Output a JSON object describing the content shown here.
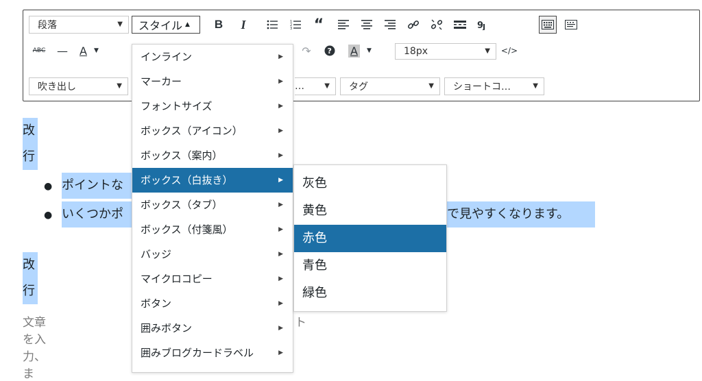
{
  "toolbar": {
    "row1": {
      "format_select": "段落",
      "style_button": "スタイル",
      "bold": "B",
      "italic": "I"
    },
    "row2": {
      "strike_label": "ABC",
      "hr_glyph": "—",
      "text_color_label": "A",
      "bg_color_label": "A",
      "font_size_select": "18px",
      "code_icon": "</>"
    },
    "row3": {
      "speech_bubble_select": "吹き出し",
      "partial_select": "…",
      "tag_select": "タグ",
      "shortcode_select": "ショートコ…"
    }
  },
  "style_menu": {
    "items": [
      {
        "label": "インライン"
      },
      {
        "label": "マーカー"
      },
      {
        "label": "フォントサイズ"
      },
      {
        "label": "ボックス（アイコン）"
      },
      {
        "label": "ボックス（案内）"
      },
      {
        "label": "ボックス（白抜き）"
      },
      {
        "label": "ボックス（タブ）"
      },
      {
        "label": "ボックス（付箋風）"
      },
      {
        "label": "バッジ"
      },
      {
        "label": "マイクロコピー"
      },
      {
        "label": "ボタン"
      },
      {
        "label": "囲みボタン"
      },
      {
        "label": "囲みブログカードラベル"
      }
    ],
    "active_index": 5
  },
  "submenu": {
    "items": [
      {
        "label": "灰色"
      },
      {
        "label": "黄色"
      },
      {
        "label": "赤色"
      },
      {
        "label": "青色"
      },
      {
        "label": "緑色"
      }
    ],
    "active_index": 2
  },
  "content": {
    "para1": "改行",
    "bullet1": "ポイントな",
    "bullet2_left": "いくつかポ",
    "bullet2_right": "で見やすくなります。",
    "para2": "改行",
    "placeholder_left": "文章を入力、ま",
    "placeholder_right": "ト"
  },
  "colors": {
    "highlight": "#b3d7ff",
    "menu_active": "#1c6fa6",
    "border": "#444444"
  }
}
